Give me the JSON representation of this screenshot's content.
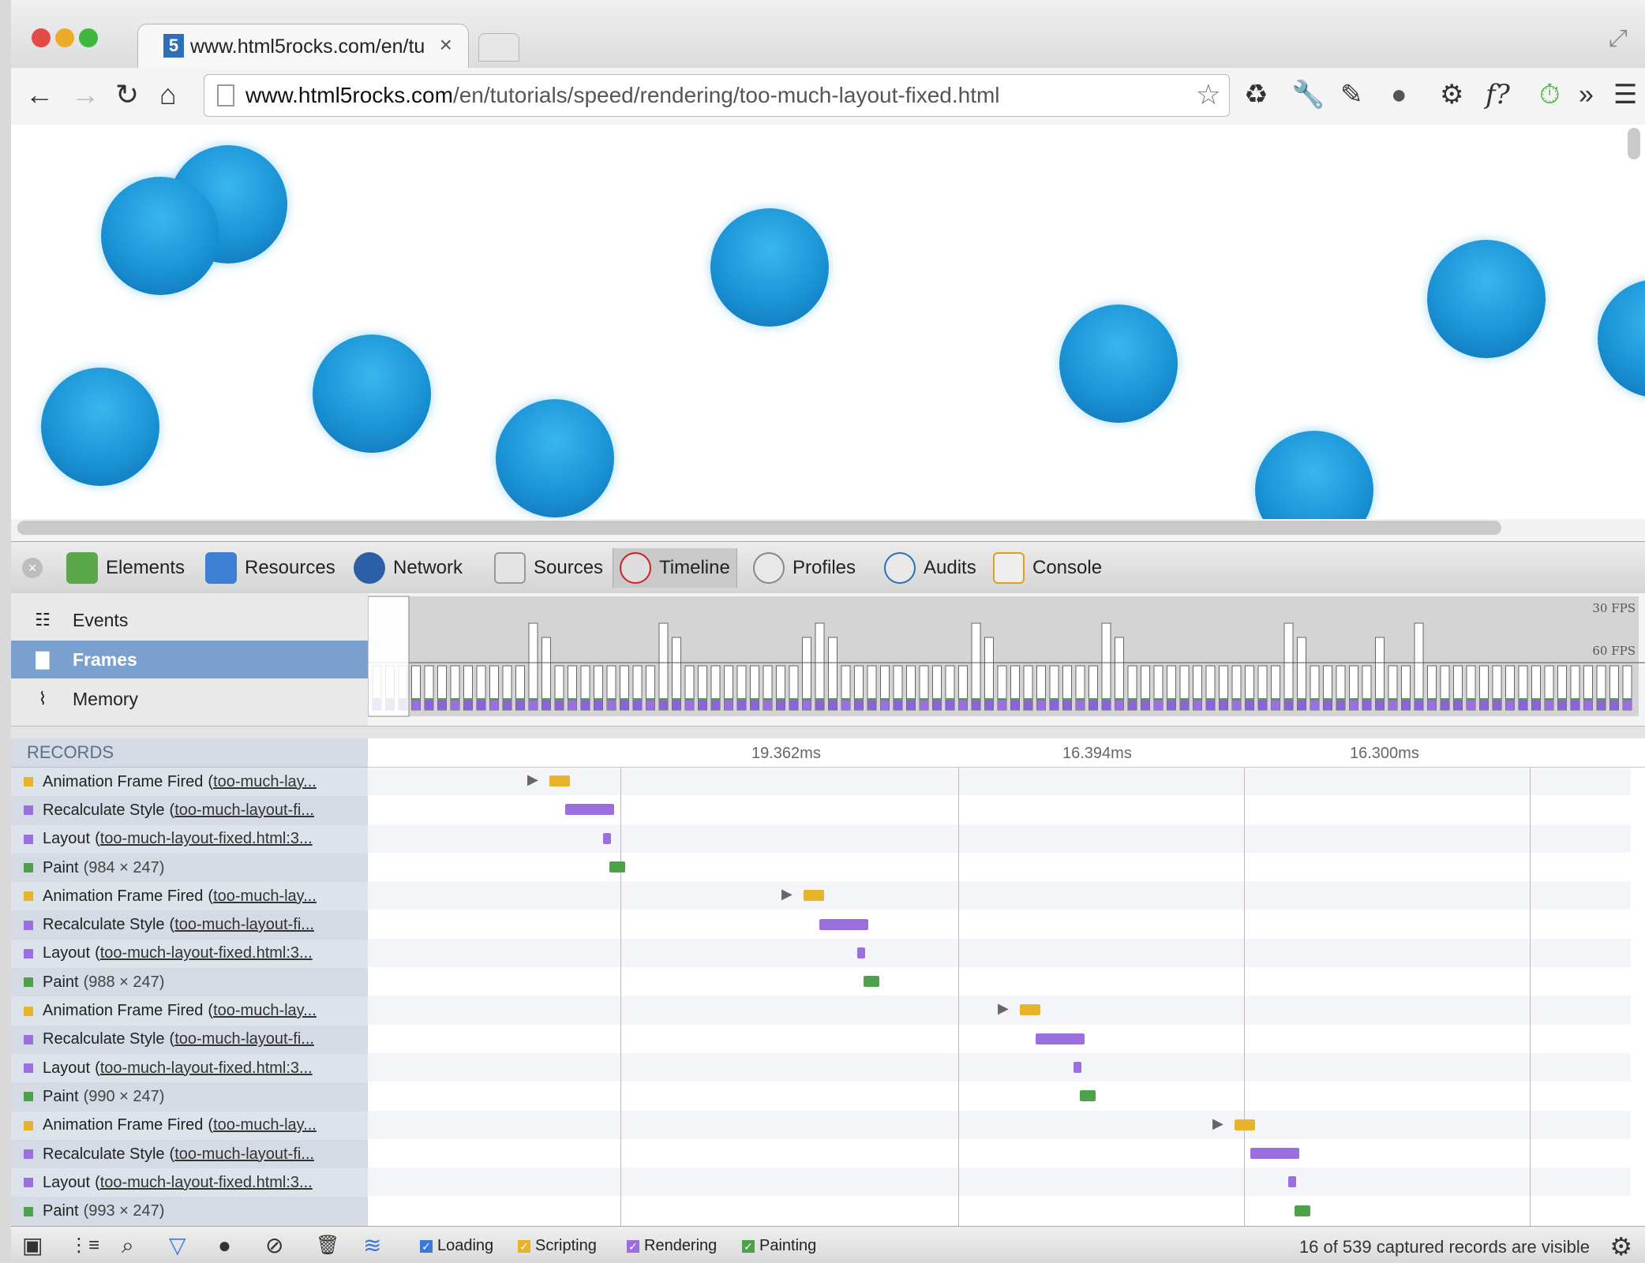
{
  "browser": {
    "tab_title": "www.html5rocks.com/en/tu",
    "tab_close": "×",
    "favicon_letter": "5",
    "url_host": "www.html5rocks.com",
    "url_path": "/en/tutorials/speed/rendering/too-much-layout-fixed.html",
    "nav": {
      "back": "←",
      "forward": "→",
      "reload": "↻",
      "home": "⌂",
      "star": "☆"
    },
    "extensions": {
      "recycle": "♻",
      "wrench": "🔧",
      "dropper": "✎",
      "record": "●",
      "gear": "⚙",
      "font": "f?",
      "timer": "⏱",
      "more": "»",
      "menu": "☰"
    },
    "traffic_lights": [
      "#e14a45",
      "#e9ad2a",
      "#3fb63c"
    ]
  },
  "devtools": {
    "tabs": [
      {
        "label": "Elements",
        "icon": "elements-icon",
        "color": "#5aa84b"
      },
      {
        "label": "Resources",
        "icon": "resources-icon",
        "color": "#3f7fd1"
      },
      {
        "label": "Network",
        "icon": "network-icon",
        "color": "#2c5ea8"
      },
      {
        "label": "Sources",
        "icon": "sources-icon",
        "color": "#c23"
      },
      {
        "label": "Timeline",
        "icon": "timeline-icon",
        "color": "#c22"
      },
      {
        "label": "Profiles",
        "icon": "profiles-icon",
        "color": "#888"
      },
      {
        "label": "Audits",
        "icon": "audits-icon",
        "color": "#2a6fb7"
      },
      {
        "label": "Console",
        "icon": "console-icon",
        "color": "#d9a21a"
      }
    ],
    "selected_tab": "Timeline",
    "timeline_nav": [
      {
        "label": "Events",
        "icon": "☷"
      },
      {
        "label": "Frames",
        "icon": "▇"
      },
      {
        "label": "Memory",
        "icon": "⌇"
      }
    ],
    "selected_nav": "Frames",
    "fps_labels": {
      "top": "30 FPS",
      "bottom": "60 FPS"
    },
    "records_header": "RECORDS",
    "ruler_labels": [
      "19.362ms",
      "16.394ms",
      "16.300ms"
    ],
    "records": [
      {
        "name": "Animation Frame Fired",
        "link": "too-much-lay...",
        "color": "#e8b32b"
      },
      {
        "name": "Recalculate Style",
        "link": "too-much-layout-fi...",
        "color": "#9b6fe0"
      },
      {
        "name": "Layout",
        "link": "too-much-layout-fixed.html:3...",
        "color": "#9b6fe0"
      },
      {
        "name": "Paint",
        "detail": "(984 × 247)",
        "color": "#4ea24a"
      },
      {
        "name": "Animation Frame Fired",
        "link": "too-much-lay...",
        "color": "#e8b32b"
      },
      {
        "name": "Recalculate Style",
        "link": "too-much-layout-fi...",
        "color": "#9b6fe0"
      },
      {
        "name": "Layout",
        "link": "too-much-layout-fixed.html:3...",
        "color": "#9b6fe0"
      },
      {
        "name": "Paint",
        "detail": "(988 × 247)",
        "color": "#4ea24a"
      },
      {
        "name": "Animation Frame Fired",
        "link": "too-much-lay...",
        "color": "#e8b32b"
      },
      {
        "name": "Recalculate Style",
        "link": "too-much-layout-fi...",
        "color": "#9b6fe0"
      },
      {
        "name": "Layout",
        "link": "too-much-layout-fixed.html:3...",
        "color": "#9b6fe0"
      },
      {
        "name": "Paint",
        "detail": "(990 × 247)",
        "color": "#4ea24a"
      },
      {
        "name": "Animation Frame Fired",
        "link": "too-much-lay...",
        "color": "#e8b32b"
      },
      {
        "name": "Recalculate Style",
        "link": "too-much-layout-fi...",
        "color": "#9b6fe0"
      },
      {
        "name": "Layout",
        "link": "too-much-layout-fixed.html:3...",
        "color": "#9b6fe0"
      },
      {
        "name": "Paint",
        "detail": "(993 × 247)",
        "color": "#4ea24a"
      }
    ],
    "filters": [
      {
        "label": "Loading",
        "color": "#3b78d8"
      },
      {
        "label": "Scripting",
        "color": "#e8b32b"
      },
      {
        "label": "Rendering",
        "color": "#9b6fe0"
      },
      {
        "label": "Painting",
        "color": "#4ea24a"
      }
    ],
    "status_message": "16 of 539 captured records are visible",
    "status_icons": {
      "dock": "▣",
      "tree": "⋮≡",
      "search": "⌕",
      "filter": "▽",
      "record": "●",
      "clear": "⊘",
      "trash": "🗑",
      "glue": "≋",
      "settings": "⚙"
    }
  }
}
